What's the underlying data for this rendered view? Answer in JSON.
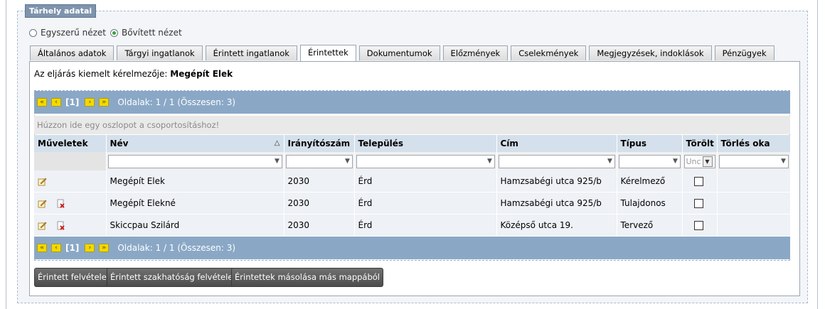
{
  "fieldset": {
    "legend": "Tárhely adatai"
  },
  "view": {
    "simple_label": "Egyszerű nézet",
    "extended_label": "Bővített nézet",
    "selected": "extended"
  },
  "tabs": [
    {
      "label": "Általános adatok",
      "active": false
    },
    {
      "label": "Tárgyi ingatlanok",
      "active": false
    },
    {
      "label": "Érintett ingatlanok",
      "active": false
    },
    {
      "label": "Érintettek",
      "active": true
    },
    {
      "label": "Dokumentumok",
      "active": false
    },
    {
      "label": "Előzmények",
      "active": false
    },
    {
      "label": "Cselekmények",
      "active": false
    },
    {
      "label": "Megjegyzések, indoklások",
      "active": false
    },
    {
      "label": "Pénzügyek",
      "active": false
    }
  ],
  "applicant": {
    "label": "Az eljárás kiemelt kérelmezője:",
    "name": "Megépít Elek"
  },
  "pager": {
    "first": "«",
    "prev": "‹",
    "current": "[1]",
    "next": "›",
    "last": "»",
    "info": "Oldalak: 1 / 1 (Összesen: 3)"
  },
  "group_hint": "Húzzon ide egy oszlopot a csoportosításhoz!",
  "columns": {
    "actions": "Műveletek",
    "name": "Név",
    "zip": "Irányítószám",
    "city": "Település",
    "address": "Cím",
    "type": "Típus",
    "deleted": "Törölt",
    "delete_reason": "Törlés oka"
  },
  "deleted_filter_value": "Unc",
  "rows": [
    {
      "name": "Megépít Elek",
      "zip": "2030",
      "city": "Érd",
      "address": "Hamzsabégi utca 925/b",
      "type": "Kérelmező",
      "deleted": false,
      "can_delete": false
    },
    {
      "name": "Megépít Elekné",
      "zip": "2030",
      "city": "Érd",
      "address": "Hamzsabégi utca 925/b",
      "type": "Tulajdonos",
      "deleted": false,
      "can_delete": true
    },
    {
      "name": "Skiccpau Szilárd",
      "zip": "2030",
      "city": "Érd",
      "address": "Középső utca 19.",
      "type": "Tervező",
      "deleted": false,
      "can_delete": true
    }
  ],
  "buttons": {
    "add_affected": "Érintett felvétele",
    "add_authority": "Érintett szakhatóság felvétele",
    "copy_affected": "Érintettek másolása más mappából"
  }
}
